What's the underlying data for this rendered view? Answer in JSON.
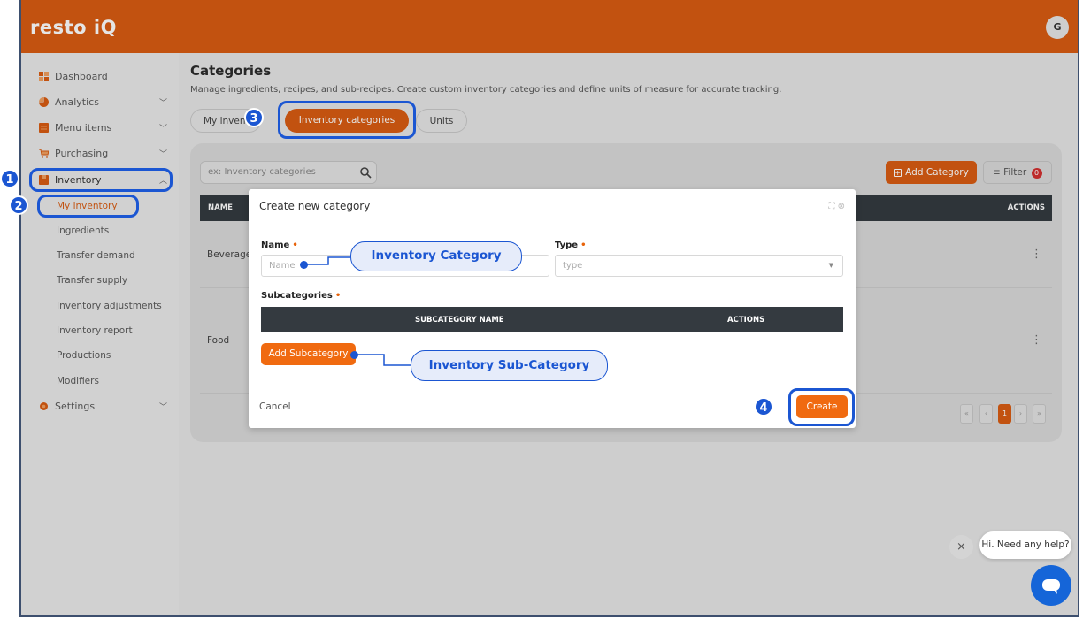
{
  "app": {
    "logo": "resto iQ",
    "avatar_initial": "G",
    "accent_color": "#d85c12",
    "highlight_color": "#1b56d2"
  },
  "sidebar": {
    "items": [
      {
        "label": "Dashboard",
        "icon": "dashboard-icon"
      },
      {
        "label": "Analytics",
        "icon": "analytics-icon",
        "chevron": "﹀"
      },
      {
        "label": "Menu items",
        "icon": "menu-items-icon",
        "chevron": "﹀"
      },
      {
        "label": "Purchasing",
        "icon": "cart-icon",
        "chevron": "﹀"
      },
      {
        "label": "Inventory",
        "icon": "inventory-icon",
        "chevron": "︿"
      },
      {
        "label": "Settings",
        "icon": "gear-icon",
        "chevron": "﹀"
      }
    ],
    "inventory_sub": [
      "My inventory",
      "Ingredients",
      "Transfer demand",
      "Transfer supply",
      "Inventory adjustments",
      "Inventory report",
      "Productions",
      "Modifiers"
    ]
  },
  "page": {
    "title": "Categories",
    "subtitle": "Manage ingredients, recipes, and sub-recipes. Create custom inventory categories and define units of measure for accurate tracking.",
    "tabs": [
      "My inven",
      "Inventory categories",
      "Units"
    ],
    "search_placeholder": "ex: Inventory categories",
    "add_category": "Add Category",
    "filter": "Filter",
    "filter_count": "0",
    "table": {
      "col_name": "NAME",
      "col_actions": "ACTIONS",
      "rows": [
        "Beverage",
        "Food"
      ]
    },
    "pager": [
      "«",
      "‹",
      "1",
      "›",
      "»"
    ]
  },
  "modal": {
    "title": "Create new category",
    "name_label": "Name",
    "name_placeholder": "Name",
    "type_label": "Type",
    "type_placeholder": "type",
    "subcategories_label": "Subcategories",
    "required_mark": "•",
    "sub_col_name": "SUBCATEGORY NAME",
    "sub_col_actions": "ACTIONS",
    "add_subcategory": "Add Subcategory",
    "cancel": "Cancel",
    "create": "Create"
  },
  "annotations": {
    "badges": [
      "1",
      "2",
      "3",
      "4"
    ],
    "callout_category": "Inventory Category",
    "callout_subcategory": "Inventory Sub-Category"
  },
  "chat": {
    "message": "Hi. Need any help?",
    "close": "×"
  }
}
